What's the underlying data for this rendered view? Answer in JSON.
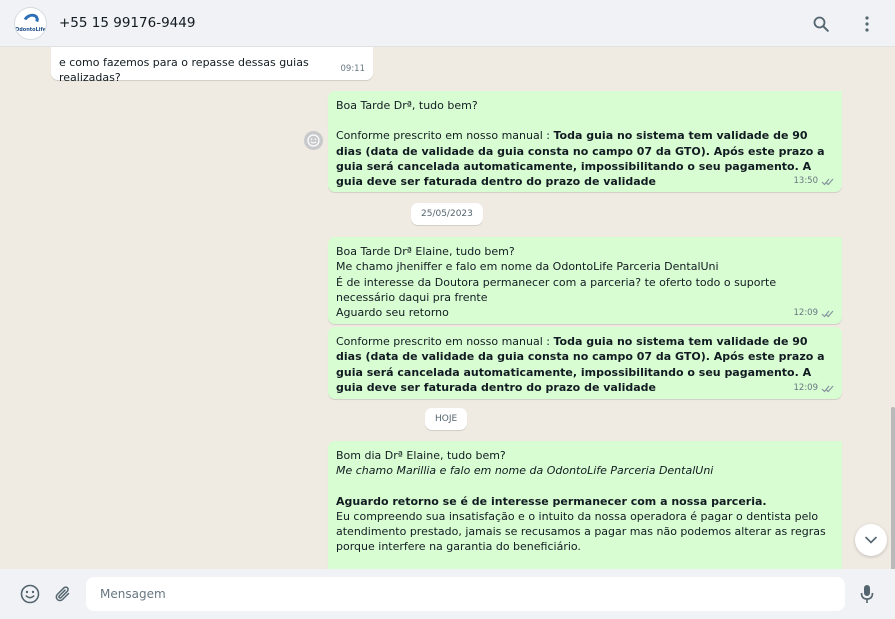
{
  "header": {
    "contact_name": "+55 15 99176-9449",
    "avatar_text": "OdontoLife",
    "icons": [
      "search-icon",
      "menu-icon"
    ]
  },
  "messages": [
    {
      "direction": "in",
      "text": "e como fazemos para o repasse dessas guias realizadas?",
      "time": "09:11"
    },
    {
      "direction": "out",
      "greeting": "Boa Tarde Drª, tudo bem?",
      "intro": "Conforme prescrito em nosso manual : ",
      "bold": "Toda guia no sistema tem validade de 90 dias (data de validade da guia consta no campo 07 da GTO). Após este prazo a guia será cancelada automaticamente, impossibilitando o seu pagamento. A guia deve ser faturada dentro do prazo de validade",
      "time": "13:50"
    },
    {
      "direction": "out",
      "text": "Boa Tarde Drª Elaine, tudo bem?\nMe chamo jheniffer e falo em nome da OdontoLife Parceria DentalUni\nÉ de interesse da Doutora permanecer com a parceria? te oferto todo o suporte necessário daqui pra frente\nAguardo seu retorno",
      "time": "12:09"
    },
    {
      "direction": "out",
      "intro": "Conforme prescrito em nosso manual : ",
      "bold": "Toda guia no sistema tem validade de 90 dias (data de validade da guia consta no campo 07 da GTO). Após este prazo a guia será cancelada automaticamente, impossibilitando o seu pagamento. A guia deve ser faturada dentro do prazo de validade",
      "time": "12:09"
    },
    {
      "direction": "out",
      "greeting": "Bom dia Drª Elaine, tudo bem?",
      "italic": "Me chamo Marillia e falo em nome da OdontoLife Parceria DentalUni",
      "bold": "Aguardo retorno se é de interesse permanecer com a nossa parceria.",
      "text": "Eu compreendo sua insatisfação e o intuito da nossa operadora é pagar o dentista pelo atendimento prestado, jamais se recusamos a pagar mas não podemos alterar as regras porque interfere na garantia do beneficiário."
    }
  ],
  "date_separators": [
    "25/05/2023",
    "HOJE"
  ],
  "composer": {
    "placeholder": "Mensagem",
    "icons": [
      "emoji-icon",
      "attach-icon",
      "mic-icon"
    ]
  },
  "colors": {
    "outgoing_bubble": "#d9fdd3",
    "incoming_bubble": "#ffffff",
    "chat_background": "#efeae2",
    "bar_background": "#f0f2f5"
  }
}
